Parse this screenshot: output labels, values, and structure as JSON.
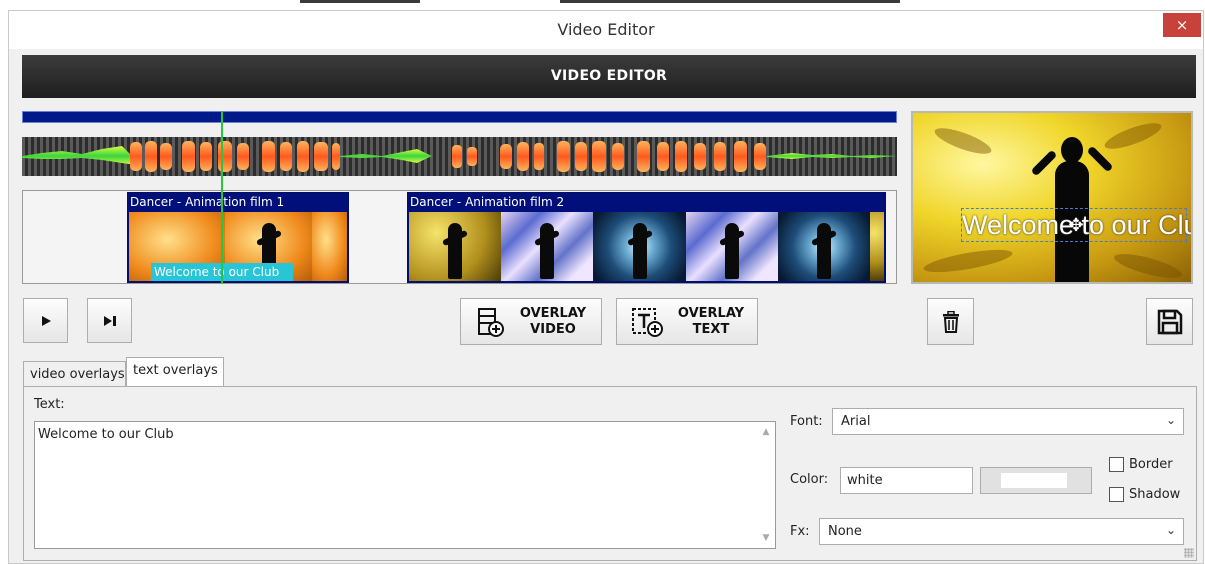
{
  "window": {
    "title": "Video Editor",
    "close_glyph": "×"
  },
  "header": {
    "title": "VIDEO EDITOR"
  },
  "timeline": {
    "clips": [
      {
        "title": "Dancer - Animation film 1"
      },
      {
        "title": "Dancer - Animation film 2"
      }
    ],
    "text_overlay_chip": "Welcome to our Club"
  },
  "preview": {
    "overlay_text": "Welcome to our Club"
  },
  "toolbar": {
    "play_icon": "play-icon",
    "next_icon": "skip-next-icon",
    "overlay_video": {
      "line1": "OVERLAY",
      "line2": "VIDEO",
      "icon": "film-add-icon"
    },
    "overlay_text": {
      "line1": "OVERLAY",
      "line2": "TEXT",
      "icon": "text-add-icon"
    },
    "delete_icon": "trash-icon",
    "save_icon": "floppy-disk-icon"
  },
  "tabs": [
    {
      "label": "video overlays",
      "active": false
    },
    {
      "label": "text overlays",
      "active": true
    }
  ],
  "form": {
    "text_label": "Text:",
    "text_value": "Welcome to our Club",
    "font_label": "Font:",
    "font_value": "Arial",
    "color_label": "Color:",
    "color_value": "white",
    "border_label": "Border",
    "shadow_label": "Shadow",
    "fx_label": "Fx:",
    "fx_value": "None"
  },
  "colors": {
    "header_bg": "#2a2a2a",
    "timeline_track": "#001a8a",
    "playhead": "#26c640",
    "overlay_chip": "#28c5d6",
    "close_button": "#c8413a"
  }
}
